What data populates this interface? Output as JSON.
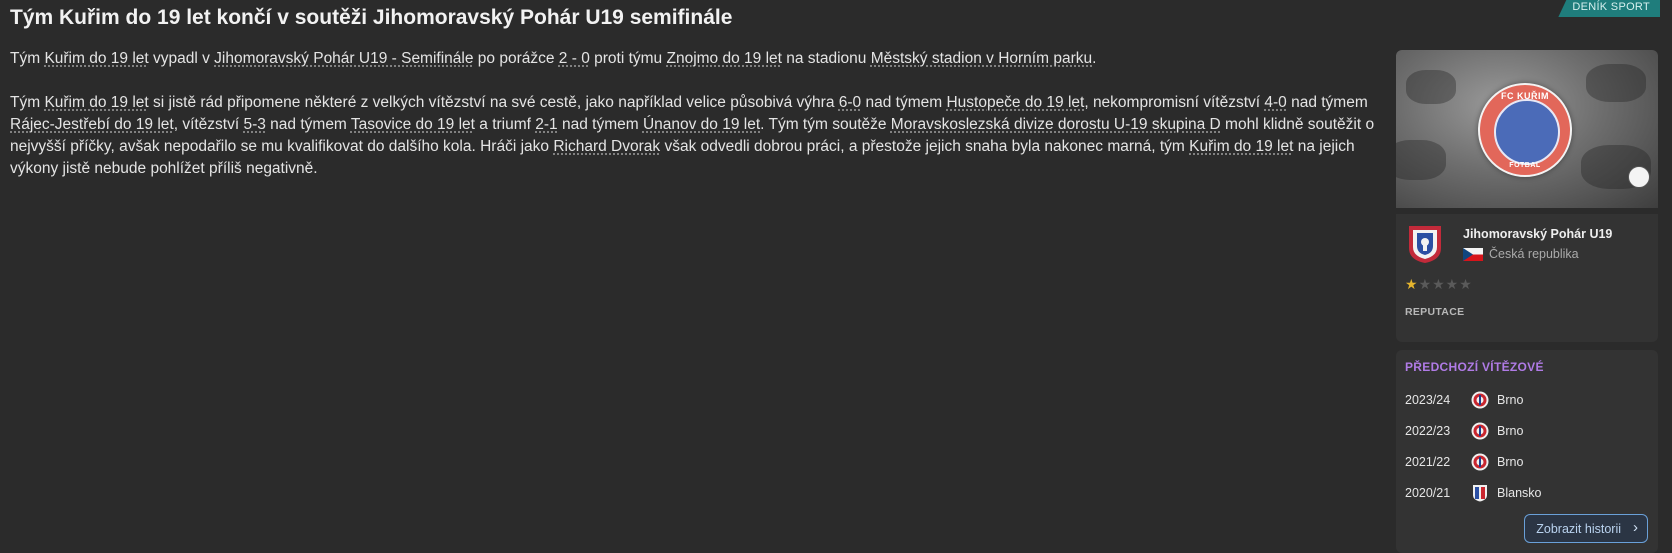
{
  "source_tag": "DENÍK SPORT",
  "headline": "Tým Kuřim do 19 let končí v soutěži Jihomoravský Pohár U19 semifinále",
  "article": {
    "p1": [
      {
        "t": "Tým "
      },
      {
        "link": "Kuřim do 19 let"
      },
      {
        "t": " vypadl v "
      },
      {
        "link": "Jihomoravský Pohár U19 - Semifinále"
      },
      {
        "t": " po porážce "
      },
      {
        "link": "2 - 0"
      },
      {
        "t": " proti týmu "
      },
      {
        "link": "Znojmo do 19 let"
      },
      {
        "t": " na stadionu "
      },
      {
        "link": "Městský stadion v Horním parku"
      },
      {
        "t": "."
      }
    ],
    "p2": [
      {
        "t": "Tým "
      },
      {
        "link": "Kuřim do 19 let"
      },
      {
        "t": " si jistě rád připomene některé z velkých vítězství na své cestě, jako například velice působivá výhra "
      },
      {
        "link": "6-0"
      },
      {
        "t": " nad týmem "
      },
      {
        "link": "Hustopeče do 19 let"
      },
      {
        "t": ", nekompromisní vítězství "
      },
      {
        "link": "4-0"
      },
      {
        "t": " nad týmem "
      },
      {
        "link": "Rájec-Jestřebí do 19 let"
      },
      {
        "t": ", vítězství "
      },
      {
        "link": "5-3"
      },
      {
        "t": " nad týmem "
      },
      {
        "link": "Tasovice do 19 let"
      },
      {
        "t": " a triumf "
      },
      {
        "link": "2-1"
      },
      {
        "t": " nad týmem "
      },
      {
        "link": "Únanov do 19 let"
      },
      {
        "t": ". Tým tým soutěže "
      },
      {
        "link": "Moravskoslezská divize dorostu U-19 skupina D"
      },
      {
        "t": " mohl klidně soutěžit o nejvyšší příčky, avšak nepodařilo se mu kvalifikovat do dalšího kola. Hráči jako "
      },
      {
        "link": "Richard Dvorak"
      },
      {
        "t": " však odvedli dobrou práci, a přestože jejich snaha byla nakonec marná, tým "
      },
      {
        "link": "Kuřim do 19 let"
      },
      {
        "t": " na jejich výkony jistě nebude pohlížet příliš negativně."
      }
    ]
  },
  "photo": {
    "badge_top": "FC KUŘIM",
    "badge_bottom": "FOTBAL"
  },
  "competition": {
    "name": "Jihomoravský Pohár U19",
    "country": "Česká republika",
    "stars_filled": 0.5,
    "stars_total": 5,
    "reputation_label": "REPUTACE"
  },
  "winners": {
    "title": "PŘEDCHOZÍ VÍTĚZOVÉ",
    "rows": [
      {
        "season": "2023/24",
        "team": "Brno",
        "crest": "brno-crest-icon"
      },
      {
        "season": "2022/23",
        "team": "Brno",
        "crest": "brno-crest-icon"
      },
      {
        "season": "2021/22",
        "team": "Brno",
        "crest": "brno-crest-icon"
      },
      {
        "season": "2020/21",
        "team": "Blansko",
        "crest": "blansko-crest-icon"
      }
    ],
    "history_button": "Zobrazit historii"
  },
  "colors": {
    "background": "#2b2b2b",
    "panel": "#333333",
    "accent_teal": "#1f7d7c",
    "winners_title": "#b07be6",
    "button_border": "#6aa0d8",
    "star_gold": "#e6b52e"
  }
}
